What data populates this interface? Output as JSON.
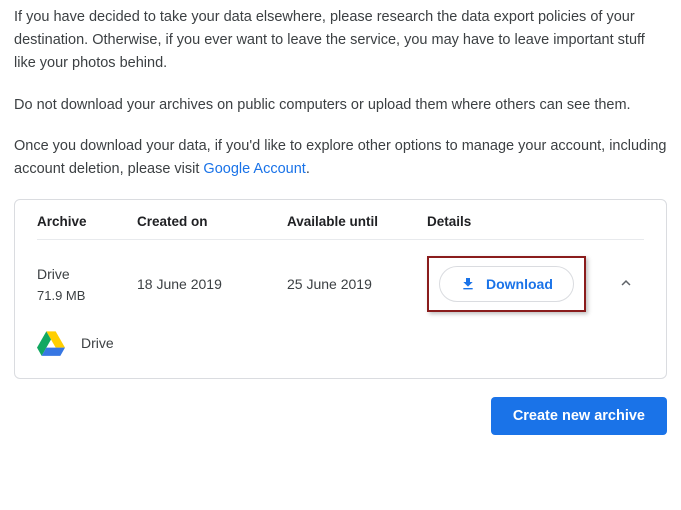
{
  "intro": {
    "p1": "If you have decided to take your data elsewhere, please research the data export policies of your destination. Otherwise, if you ever want to leave the service, you may have to leave important stuff like your photos behind.",
    "p2": "Do not download your archives on public computers or upload them where others can see them.",
    "p3_pre": "Once you download your data, if you'd like to explore other options to manage your account, including account deletion, please visit ",
    "p3_link": "Google Account",
    "p3_post": "."
  },
  "table": {
    "headers": {
      "archive": "Archive",
      "created": "Created on",
      "available": "Available until",
      "details": "Details"
    },
    "row": {
      "name": "Drive",
      "size": "71.9 MB",
      "created": "18 June 2019",
      "available": "25 June 2019",
      "download_label": "Download"
    },
    "content": {
      "label": "Drive"
    }
  },
  "footer": {
    "create_label": "Create new archive"
  }
}
